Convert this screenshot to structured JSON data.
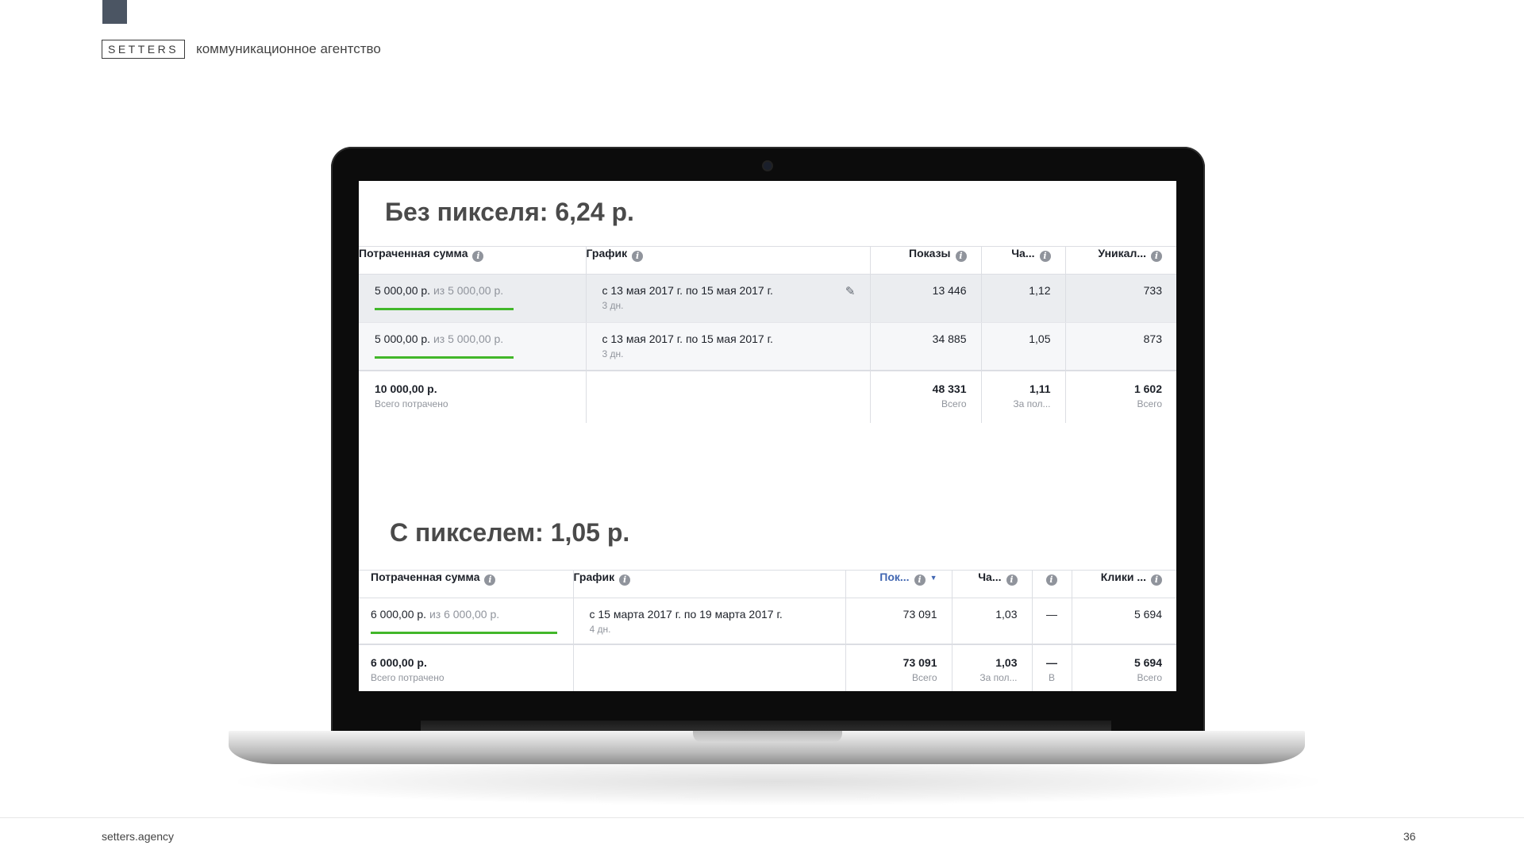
{
  "header": {
    "logo": "SETTERS",
    "tagline": "коммуникационное агентство"
  },
  "footer": {
    "url": "setters.agency",
    "page_number": "36"
  },
  "table1": {
    "title": "Без пикселя: 6,24 р.",
    "columns": {
      "spent": "Потраченная сумма",
      "schedule": "График",
      "impressions": "Показы",
      "frequency": "Ча...",
      "unique": "Уникал..."
    },
    "rows": [
      {
        "spent": "5 000,00 р.",
        "budget": "из 5 000,00 р.",
        "budget_progress_percent": 100,
        "schedule": "с 13 мая 2017 г. по 15 мая 2017 г.",
        "duration": "3 дн.",
        "impressions": "13 446",
        "frequency": "1,12",
        "unique": "733"
      },
      {
        "spent": "5 000,00 р.",
        "budget": "из 5 000,00 р.",
        "budget_progress_percent": 100,
        "schedule": "с 13 мая 2017 г. по 15 мая 2017 г.",
        "duration": "3 дн.",
        "impressions": "34 885",
        "frequency": "1,05",
        "unique": "873"
      }
    ],
    "total": {
      "spent": "10 000,00 р.",
      "spent_label": "Всего потрачено",
      "impressions": "48 331",
      "impressions_label": "Всего",
      "frequency": "1,11",
      "frequency_label": "За пол...",
      "unique": "1 602",
      "unique_label": "Всего"
    }
  },
  "table2": {
    "title": "С пикселем: 1,05 р.",
    "columns": {
      "spent": "Потраченная сумма",
      "schedule": "График",
      "impressions": "Пок...",
      "frequency": "Ча...",
      "extra": "",
      "clicks": "Клики ..."
    },
    "rows": [
      {
        "spent": "6 000,00 р.",
        "budget": "из 6 000,00 р.",
        "budget_progress_percent": 100,
        "schedule": "с 15 марта 2017 г. по 19 марта 2017 г.",
        "duration": "4 дн.",
        "impressions": "73 091",
        "frequency": "1,03",
        "extra": "—",
        "clicks": "5 694"
      }
    ],
    "total": {
      "spent": "6 000,00 р.",
      "spent_label": "Всего потрачено",
      "impressions": "73 091",
      "impressions_label": "Всего",
      "frequency": "1,03",
      "frequency_label": "За пол...",
      "extra": "—",
      "extra_label": "В",
      "clicks": "5 694",
      "clicks_label": "Всего"
    }
  },
  "colors": {
    "budget_bar": "#42b72a",
    "sort_accent": "#4267b2",
    "title_gray": "#4a4a4a"
  },
  "icons": [
    "info-icon",
    "pencil-icon",
    "sort-down-icon"
  ]
}
